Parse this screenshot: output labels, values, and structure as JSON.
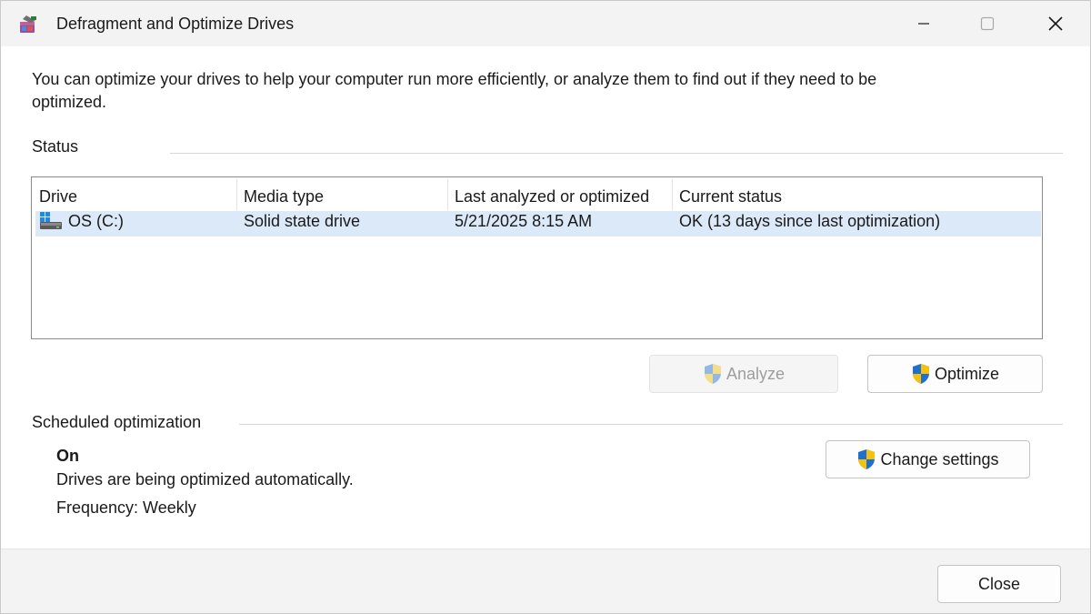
{
  "window": {
    "title": "Defragment and Optimize Drives",
    "app_icon": "defrag-app-icon",
    "controls": [
      "minimize-icon",
      "maximize-icon",
      "close-icon"
    ]
  },
  "intro_text": "You can optimize your drives to help your computer run more efficiently, or analyze them to find out if they need to be optimized.",
  "status": {
    "label": "Status",
    "columns": [
      "Drive",
      "Media type",
      "Last analyzed or optimized",
      "Current status"
    ],
    "rows": [
      {
        "drive": "OS (C:)",
        "media_type": "Solid state drive",
        "last_analyzed": "5/21/2025 8:15 AM",
        "current_status": "OK (13 days since last optimization)",
        "icon": "windows-drive-icon",
        "selected": true
      }
    ],
    "analyze_label": "Analyze",
    "analyze_enabled": false,
    "optimize_label": "Optimize"
  },
  "scheduled": {
    "label": "Scheduled optimization",
    "state": "On",
    "description": "Drives are being optimized automatically.",
    "frequency": "Frequency: Weekly",
    "change_settings_label": "Change settings"
  },
  "footer": {
    "close_label": "Close"
  },
  "colors": {
    "selection": "#dbe9f8",
    "shield_blue": "#1e6fd0",
    "shield_yellow": "#f4c20d"
  }
}
